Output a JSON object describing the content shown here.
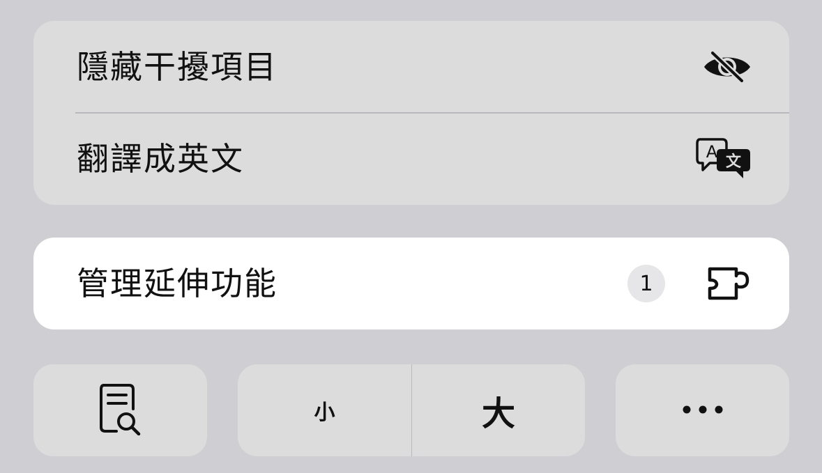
{
  "menu": {
    "hide_distracting_label": "隱藏干擾項目",
    "translate_label": "翻譯成英文",
    "manage_extensions_label": "管理延伸功能",
    "extensions_badge": "1"
  },
  "toolbar": {
    "smaller_text_label": "小",
    "larger_text_label": "大"
  },
  "icons": {
    "hide": "eye-slash-icon",
    "translate": "translate-bubbles-icon",
    "extensions": "puzzle-piece-icon",
    "reader": "reader-document-icon",
    "more": "ellipsis-icon"
  },
  "colors": {
    "background": "#cfced3",
    "card": "#dcdcdc",
    "highlight": "#ffffff",
    "badge": "#e6e6e8"
  }
}
